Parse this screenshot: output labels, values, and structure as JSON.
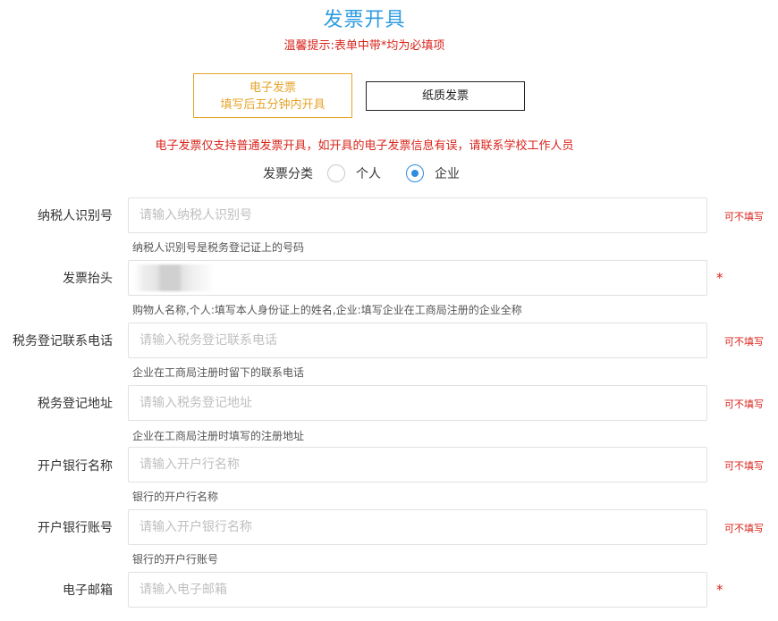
{
  "header": {
    "title": "发票开具",
    "tip": "温馨提示:表单中带*均为必填项"
  },
  "invoice_type": {
    "electronic_line1": "电子发票",
    "electronic_line2": "填写后五分钟内开具",
    "paper": "纸质发票",
    "selected": "electronic"
  },
  "notice": "电子发票仅支持普通发票开具，如开具的电子发票信息有误，请联系学校工作人员",
  "category": {
    "label": "发票分类",
    "options": [
      "个人",
      "企业"
    ],
    "selected": "企业"
  },
  "fields": [
    {
      "label": "纳税人识别号",
      "placeholder": "请输入纳税人识别号",
      "value": "",
      "hint": "纳税人识别号是税务登记证上的号码",
      "note": "可不填写"
    },
    {
      "label": "发票抬头",
      "placeholder": "",
      "value": "",
      "hint": "购物人名称,个人:填写本人身份证上的姓名,企业:填写企业在工商局注册的企业全称",
      "note": "*"
    },
    {
      "label": "税务登记联系电话",
      "placeholder": "请输入税务登记联系电话",
      "value": "",
      "hint": "企业在工商局注册时留下的联系电话",
      "note": "可不填写"
    },
    {
      "label": "税务登记地址",
      "placeholder": "请输入税务登记地址",
      "value": "",
      "hint": "企业在工商局注册时填写的注册地址",
      "note": "可不填写"
    },
    {
      "label": "开户银行名称",
      "placeholder": "请输入开户行名称",
      "value": "",
      "hint": "银行的开户行名称",
      "note": "可不填写"
    },
    {
      "label": "开户银行账号",
      "placeholder": "请输入开户银行名称",
      "value": "",
      "hint": "银行的开户行账号",
      "note": "可不填写"
    },
    {
      "label": "电子邮箱",
      "placeholder": "请输入电子邮箱",
      "value": "",
      "hint": "",
      "note": "*"
    }
  ],
  "colors": {
    "title": "#2e9ce0",
    "warning": "#d9251c",
    "electronic_accent": "#e5a42a",
    "radio_checked": "#2e8ce0"
  }
}
